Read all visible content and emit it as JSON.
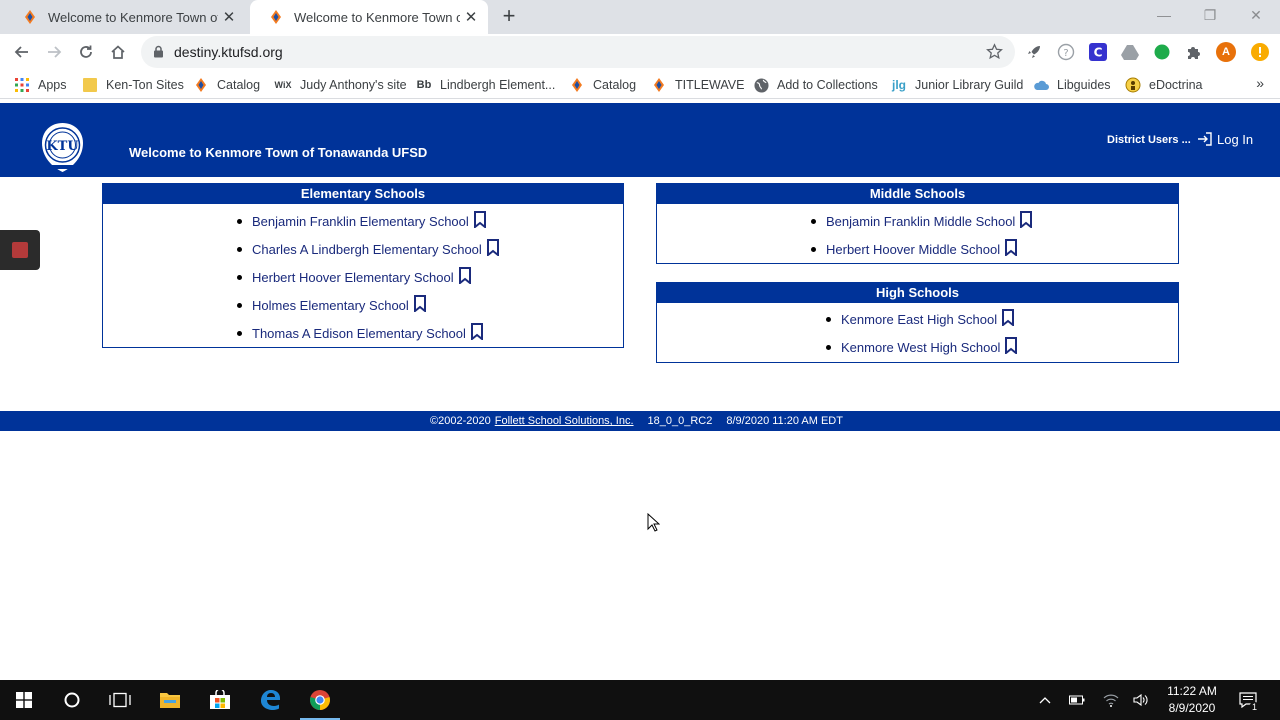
{
  "browser": {
    "tabs": [
      {
        "title": "Welcome to Kenmore Town of To",
        "active": false
      },
      {
        "title": "Welcome to Kenmore Town of To",
        "active": true
      }
    ],
    "url": "destiny.ktufsd.org",
    "profile_initial": "A"
  },
  "bookmarks": [
    {
      "label": "Apps",
      "icon": "apps-grid-icon"
    },
    {
      "label": "Ken-Ton Sites",
      "icon": "folder-icon"
    },
    {
      "label": "Catalog",
      "icon": "destiny-icon"
    },
    {
      "label": "Judy Anthony's site",
      "icon": "wix-icon",
      "icon_text": "WiX"
    },
    {
      "label": "Lindbergh Element...",
      "icon": "blackboard-icon",
      "icon_text": "Bb"
    },
    {
      "label": "Catalog",
      "icon": "destiny-icon"
    },
    {
      "label": "TITLEWAVE",
      "icon": "destiny-icon"
    },
    {
      "label": "Add to Collections",
      "icon": "globe-icon"
    },
    {
      "label": "Junior Library Guild",
      "icon": "jlg-icon",
      "icon_text": "jlg"
    },
    {
      "label": "Libguides",
      "icon": "cloud-icon"
    },
    {
      "label": "eDoctrina",
      "icon": "edoctrina-icon"
    }
  ],
  "header": {
    "title": "Welcome to Kenmore Town of Tonawanda UFSD",
    "district_users": "District Users ...",
    "login": "Log In",
    "logo_text": "KTU"
  },
  "panels": {
    "elementary": {
      "title": "Elementary Schools",
      "schools": [
        "Benjamin Franklin Elementary School",
        "Charles A Lindbergh Elementary School",
        "Herbert Hoover Elementary School",
        "Holmes Elementary School",
        "Thomas A Edison Elementary School"
      ]
    },
    "middle": {
      "title": "Middle Schools",
      "schools": [
        "Benjamin Franklin Middle School",
        "Herbert Hoover Middle School"
      ]
    },
    "high": {
      "title": "High Schools",
      "schools": [
        "Kenmore East High School",
        "Kenmore West High School"
      ]
    }
  },
  "footer": {
    "copyright": "©2002-2020",
    "company": "Follett School Solutions, Inc.",
    "version": "18_0_0_RC2",
    "timestamp": "8/9/2020 11:20 AM EDT"
  },
  "taskbar": {
    "time": "11:22 AM",
    "date": "8/9/2020",
    "notification_count": "1"
  },
  "colors": {
    "brand_blue": "#003399",
    "link": "#1a2a7c"
  }
}
